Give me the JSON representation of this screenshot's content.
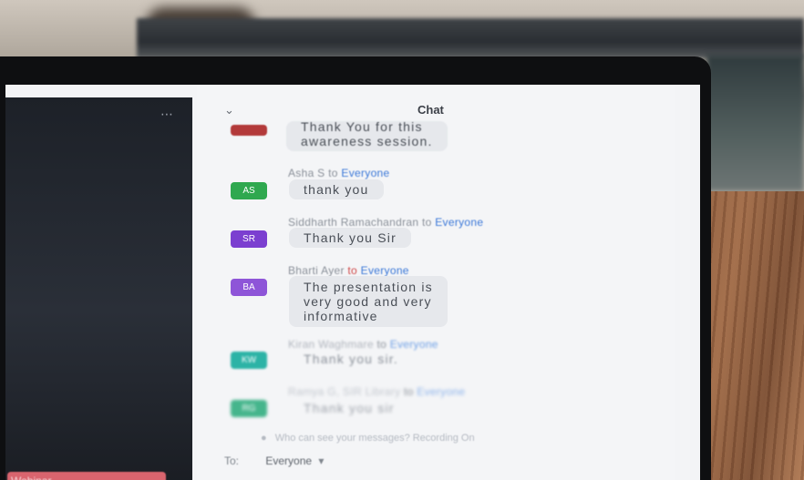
{
  "chat": {
    "title": "Chat",
    "collapse_glyph": "⌄",
    "close_glyph": "×",
    "messages": [
      {
        "sender": "",
        "to": "",
        "recipient": "",
        "initials": "",
        "avatar_color": "#b33a3a",
        "lines": [
          "Thank You for this",
          "awareness session."
        ]
      },
      {
        "sender": "Asha S",
        "to": "to",
        "recipient": "Everyone",
        "initials": "AS",
        "avatar_color": "#2fa84f",
        "lines": [
          "thank you"
        ]
      },
      {
        "sender": "Siddharth Ramachandran",
        "to": "to",
        "recipient": "Everyone",
        "initials": "SR",
        "avatar_color": "#7b3fd0",
        "lines": [
          "Thank you Sir"
        ]
      },
      {
        "sender": "Bharti Ayer",
        "to": "to",
        "recipient": "Everyone",
        "initials": "BA",
        "avatar_color": "#8e55d8",
        "lines": [
          "The presentation is",
          "very good and very",
          "informative"
        ]
      },
      {
        "sender": "Kiran Waghmare",
        "to": "to",
        "recipient": "Everyone",
        "initials": "KW",
        "avatar_color": "#2cb3a6",
        "lines": [
          "Thank you sir."
        ]
      },
      {
        "sender": "Ramya G, SIR Library",
        "to": "to",
        "recipient": "Everyone",
        "initials": "RG",
        "avatar_color": "#45b58c",
        "lines": [
          "Thank you sir"
        ]
      }
    ],
    "input_hint": "Who can see your messages? Recording On",
    "to_label": "To:",
    "to_value": "Everyone"
  },
  "video": {
    "participant_name": "Webinar",
    "more_glyph": "⋯"
  }
}
